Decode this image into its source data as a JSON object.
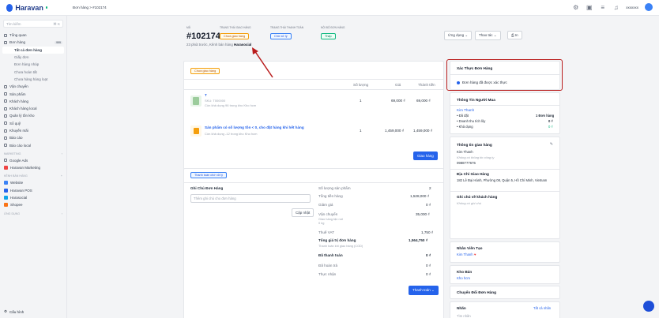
{
  "topbar": {
    "brand": "Haravan",
    "breadcrumb": "Đơn hàng > #102174",
    "account": "xxxxxxx"
  },
  "sidebar": {
    "search_placeholder": "Tìm kiếm",
    "search_shortcut": "⌘ K",
    "items": [
      {
        "label": "Tổng quan"
      },
      {
        "label": "Đơn hàng",
        "badge": "999"
      },
      {
        "label": "Tất cả đơn hàng"
      },
      {
        "label": "Giấy đơn"
      },
      {
        "label": "Đơn hàng nháp"
      },
      {
        "label": "Chưa hoàn tất"
      },
      {
        "label": "Chưa hàng hàng loạt"
      },
      {
        "label": "Vận chuyển"
      },
      {
        "label": "Sản phẩm"
      },
      {
        "label": "Khách hàng"
      },
      {
        "label": "Khách hàng local"
      },
      {
        "label": "Quản lý tồn kho"
      },
      {
        "label": "Sổ quỹ"
      },
      {
        "label": "Khuyến mãi"
      },
      {
        "label": "Báo cáo"
      },
      {
        "label": "Báo cáo local"
      }
    ],
    "section_marketing": "MARKETING",
    "marketing_items": [
      {
        "label": "Google Ads"
      },
      {
        "label": "Haravan Marketing"
      }
    ],
    "section_channels": "KÊNH BÁN HÀNG",
    "channel_items": [
      {
        "label": "Website"
      },
      {
        "label": "Haravan POS"
      },
      {
        "label": "Harasocial"
      },
      {
        "label": "Shopee"
      }
    ],
    "section_apps": "ỨNG DỤNG",
    "footer": "Cấu hình"
  },
  "header": {
    "label_order": "Mã",
    "label_delivery": "Trạng thái giao hàng",
    "label_payment": "Trạng thái thanh toán",
    "label_source": "Nội bộ đơn hàng",
    "order_id": "#102174",
    "delivery_status": "Chưa giao hàng",
    "payment_status": "Chờ xử lý",
    "source_status": "Thấp",
    "sub_prefix": "23 phút trước, Kênh bán hàng",
    "sub_channel": "Harasocial",
    "btn_apps": "Ứng dụng ⌄",
    "btn_actions": "Thao tác ⌄",
    "btn_print": "In"
  },
  "items_panel": {
    "status_pill": "Chưa giao hàng",
    "col_qty": "Số lượng",
    "col_price": "Giá",
    "col_total": "Thành tiền",
    "lines": [
      {
        "name": "T",
        "sku": "SKU: T000000",
        "stock": "Còn khả dụng 96 trong kho Kho hcm",
        "qty": "1",
        "price": "69,000 ₫",
        "total": "69,000 ₫"
      },
      {
        "name": "Sản phẩm có số lượng tồn < 0, cho đặt hàng khi hết hàng",
        "sku": "",
        "stock": "Còn khả dụng -12 trong kho Kho hcm",
        "qty": "1",
        "price": "1,459,000 ₫",
        "total": "1,459,000 ₫"
      }
    ],
    "btn_deliver": "Giao hàng"
  },
  "payment_panel": {
    "status_pill": "Thanh toán chờ xử lý",
    "note_title": "Ghi Chú Đơn Hàng",
    "note_placeholder": "Thêm ghi chú cho đơn hàng",
    "btn_update": "Cập nhật",
    "rows": [
      {
        "label": "Số lượng sản phẩm",
        "value": "2"
      },
      {
        "label": "Tổng tiền hàng",
        "value": "1,528,000 ₫"
      },
      {
        "label": "Giảm giá",
        "value": "0 ₫"
      },
      {
        "label": "Vận chuyển",
        "value": "35,000 ₫"
      },
      {
        "label": "Thuế VAT",
        "value": "1,750 ₫"
      },
      {
        "label": "Tổng giá trị đơn hàng",
        "value": "1,564,750 ₫"
      },
      {
        "label": "Đã thanh toán",
        "value": "0 ₫"
      },
      {
        "label": "Đã hoàn trả",
        "value": "0 ₫"
      },
      {
        "label": "Thực nhận",
        "value": "0 ₫"
      }
    ],
    "shipping_sub": "Giao hàng tận nơi",
    "shipping_weight": "0 kg",
    "cod_note": "Thanh toán khi giao hàng (COD)",
    "btn_pay": "Thanh toán ⌄"
  },
  "right": {
    "verify_title": "Xác Thực Đơn Hàng",
    "verify_text": "Đơn hàng đã được xác thực",
    "buyer_title": "Thông Tin Người Mua",
    "buyer_name": "Kim Thanh",
    "buyer_stats": [
      {
        "label": "• Đã đặt",
        "value": "1 Đơn hàng"
      },
      {
        "label": "• Doanh thu tích lũy",
        "value": "0 ₫"
      },
      {
        "label": "• Khả dụng",
        "value": "0 ₫"
      }
    ],
    "shipping_title": "Thông tin giao hàng",
    "ship_name": "Kim Thanh",
    "ship_email": "Không có thông tin công ty",
    "ship_phone": "0988777676",
    "address_title": "Địa Chỉ Giao Hàng",
    "address": "182 Lê Đại Hành, Phường 08, Quận 5, Hồ Chí Minh, Vietnam",
    "cust_note_title": "Ghi chú về khách hàng",
    "cust_note": "Không có ghi chú",
    "staff_title": "Nhân Viên Tạo",
    "staff_name": "Kim Thanh",
    "warehouse_title": "Kho Bán",
    "warehouse_name": "Kho hcm",
    "transfer_title": "Chuyển Đổi Đơn Hàng",
    "tags_title": "Nhãn",
    "tags_link": "Tất cả nhãn",
    "tags_placeholder": "Tìm nhãn"
  },
  "colors": {
    "primary": "#2563eb",
    "annotation": "#b91c1c"
  }
}
